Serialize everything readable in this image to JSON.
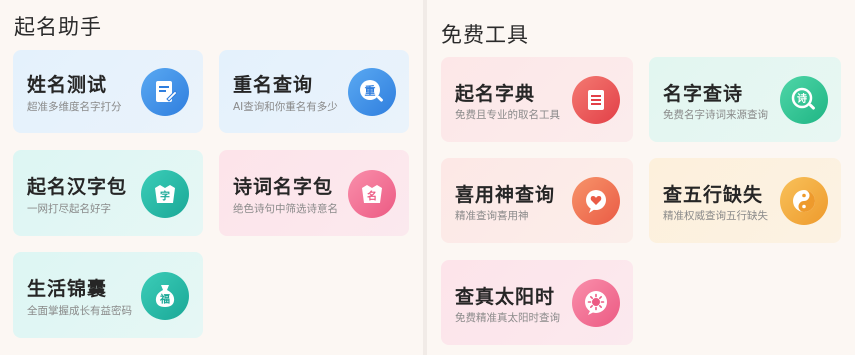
{
  "left_section": {
    "title": "起名助手",
    "cards": [
      {
        "title": "姓名测试",
        "subtitle": "超准多维度名字打分",
        "icon": "name-test-icon"
      },
      {
        "title": "重名查询",
        "subtitle": "AI查询和你重名有多少",
        "icon": "duplicate-search-icon",
        "icon_text": "重"
      },
      {
        "title": "起名汉字包",
        "subtitle": "一网打尽起名好字",
        "icon": "character-pack-icon",
        "icon_text": "字"
      },
      {
        "title": "诗词名字包",
        "subtitle": "绝色诗句中筛选诗意名",
        "icon": "poetry-pack-icon",
        "icon_text": "名"
      },
      {
        "title": "生活锦囊",
        "subtitle": "全面掌握成长有益密码",
        "icon": "money-bag-icon",
        "icon_text": "福"
      }
    ]
  },
  "right_section": {
    "title": "免费工具",
    "cards": [
      {
        "title": "起名字典",
        "subtitle": "免费且专业的取名工具",
        "icon": "dictionary-icon"
      },
      {
        "title": "名字查诗",
        "subtitle": "免费名字诗词来源查询",
        "icon": "poem-search-icon",
        "icon_text": "诗"
      },
      {
        "title": "喜用神查询",
        "subtitle": "精准查询喜用神",
        "icon": "heart-bubble-icon"
      },
      {
        "title": "查五行缺失",
        "subtitle": "精准权威查询五行缺失",
        "icon": "yin-yang-icon"
      },
      {
        "title": "查真太阳时",
        "subtitle": "免费精准真太阳时查询",
        "icon": "sun-icon"
      }
    ]
  },
  "colors": {
    "blue": "#3c8fe8",
    "teal": "#22b8a6",
    "pink": "#f06a8e",
    "red": "#e6454a",
    "orange": "#f58a4c",
    "gold": "#f2a634"
  }
}
